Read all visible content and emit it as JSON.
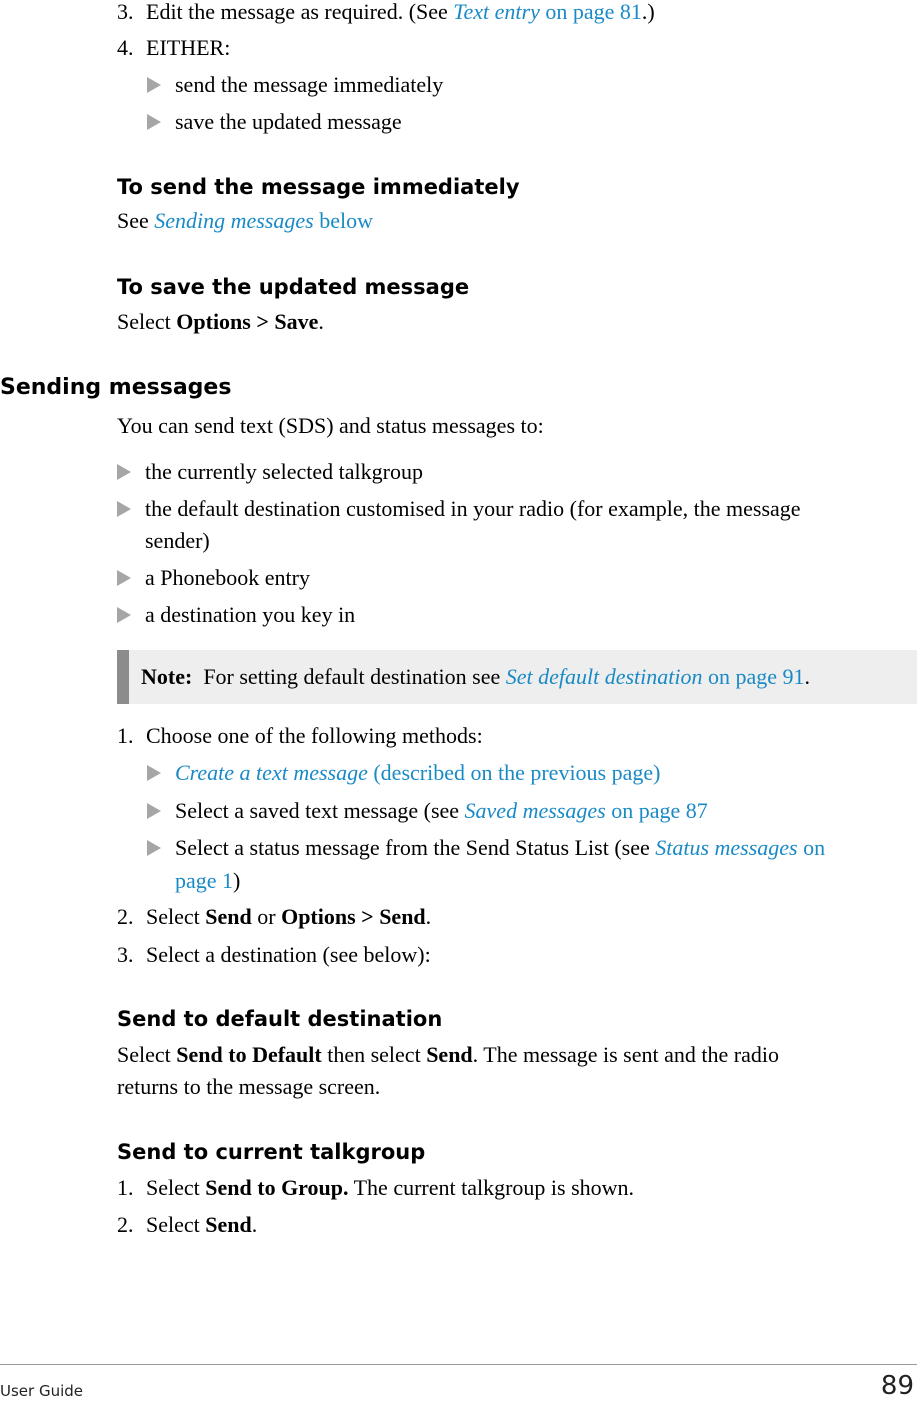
{
  "top_steps": {
    "step3": {
      "num": "3.",
      "pre": "Edit the message as required. (See ",
      "link_italic": "Text entry",
      "link_rest": " on page 81",
      "post": ".)"
    },
    "step4": {
      "num": "4.",
      "text": "EITHER:"
    },
    "step4_bullets": [
      "send the message immediately",
      "save the updated message"
    ]
  },
  "send_immediately": {
    "heading": "To send the message immediately",
    "pre": "See ",
    "link_italic": "Sending messages",
    "link_rest": " below"
  },
  "save_updated": {
    "heading": "To save the updated message",
    "pre": "Select ",
    "bold": "Options > Save",
    "post": "."
  },
  "sending_messages": {
    "heading": "Sending messages",
    "intro": "You can send text (SDS) and status messages to:",
    "bullets": [
      "the currently selected talkgroup",
      "the default destination customised in your radio (for example, the message",
      "sender)",
      "a Phonebook entry",
      "a destination you key in"
    ],
    "note": {
      "label": "Note:",
      "pre": "  For setting default destination see ",
      "link_italic": "Set default destination",
      "link_rest": " on page 91",
      "post": "."
    },
    "steps": {
      "s1": {
        "num": "1.",
        "text": "Choose one of the following methods:"
      },
      "s1_bullets": {
        "b1": {
          "link_italic": "Create a text message",
          "link_rest": " (described on the previous page)"
        },
        "b2": {
          "pre": "Select a saved text message (see ",
          "link_italic": "Saved messages",
          "link_rest": " on page 87"
        },
        "b3": {
          "pre": "Select a status message from the Send Status List (see ",
          "link_italic": "Status messages",
          "link_rest": " on",
          "line2": "page 1",
          "post": ")"
        }
      },
      "s2": {
        "num": "2.",
        "pre": "Select ",
        "bold1": "Send",
        "mid": " or ",
        "bold2": "Options > Send",
        "post": "."
      },
      "s3": {
        "num": "3.",
        "text": "Select a destination (see below):"
      }
    }
  },
  "send_default": {
    "heading": "Send to default destination",
    "pre": "Select ",
    "bold1": "Send to Default",
    "mid": " then select ",
    "bold2": "Send",
    "post": ". The message is sent and the radio",
    "line2": "returns to the message screen."
  },
  "send_group": {
    "heading": "Send to current talkgroup",
    "s1": {
      "num": "1.",
      "pre": "Select ",
      "bold": "Send to Group.",
      "post": " The current talkgroup is shown."
    },
    "s2": {
      "num": "2.",
      "pre": "Select ",
      "bold": "Send",
      "post": "."
    }
  },
  "footer": {
    "left": "User Guide",
    "page_number": "89"
  },
  "colors": {
    "link": "#1a8ac6",
    "bullet": "#a6a6a6",
    "note_bg": "#eeeeee",
    "note_bar": "#8c8c8c"
  }
}
